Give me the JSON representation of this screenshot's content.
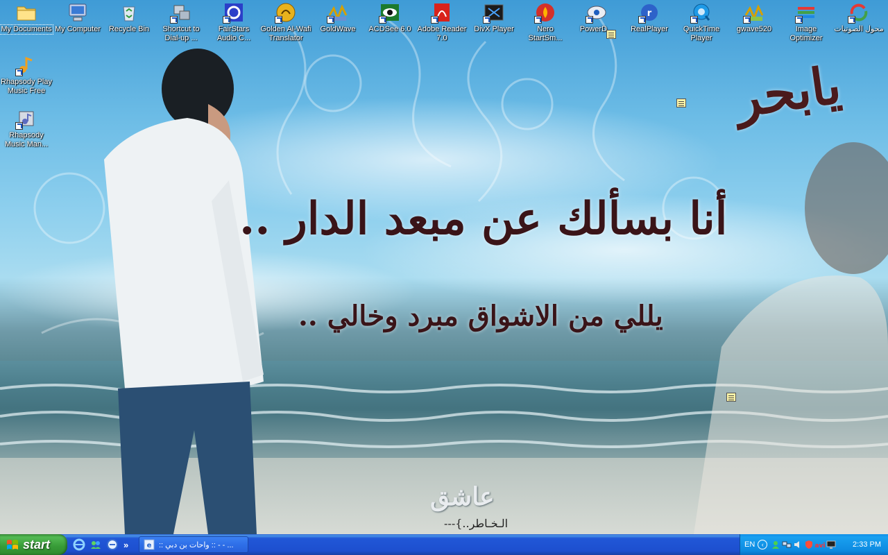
{
  "desktop": {
    "icons_top": [
      {
        "label": "My Documents",
        "icon": "folder-icon"
      },
      {
        "label": "My Computer",
        "icon": "computer-icon"
      },
      {
        "label": "Recycle Bin",
        "icon": "recycle-bin-icon"
      },
      {
        "label": "Shortcut to Dial-up ...",
        "icon": "dialup-icon"
      },
      {
        "label": "FairStars Audio C...",
        "icon": "fairstars-icon"
      },
      {
        "label": "Golden Al-Wafi Translator",
        "icon": "translator-icon"
      },
      {
        "label": "GoldWave",
        "icon": "goldwave-icon"
      },
      {
        "label": "ACDSee 6.0",
        "icon": "acdsee-icon"
      },
      {
        "label": "Adobe Reader 7.0",
        "icon": "adobe-reader-icon"
      },
      {
        "label": "DivX Player",
        "icon": "divx-icon"
      },
      {
        "label": "Nero StartSm...",
        "icon": "nero-icon"
      },
      {
        "label": "PowerD...",
        "icon": "powerdvd-icon"
      },
      {
        "label": "RealPlayer",
        "icon": "realplayer-icon"
      },
      {
        "label": "QuickTime Player",
        "icon": "quicktime-icon"
      },
      {
        "label": "gwave520",
        "icon": "gwave-icon"
      },
      {
        "label": "Image Optimizer",
        "icon": "image-optimizer-icon"
      },
      {
        "label": "محول الصوتيات",
        "icon": "audio-converter-icon"
      }
    ],
    "icons_left": [
      {
        "label": "Rhapsody Play Music Free",
        "icon": "rhapsody-play-icon"
      },
      {
        "label": "Rhapsody Music Man...",
        "icon": "rhapsody-manager-icon"
      }
    ]
  },
  "wallpaper": {
    "title": "يابحر",
    "line1": "أنا بسألك عن مبعد الدار ..",
    "line2": "يللي من الاشواق مبرد وخالي ..",
    "signature": "عاشق",
    "signature_sub": "الـخـاطر..}---"
  },
  "taskbar": {
    "start_label": "start",
    "task_window": ":: واحات بن دبي :: - - ...",
    "quick_more": "»",
    "language": "EN",
    "clock": "2:33 PM"
  },
  "colors": {
    "taskbar_blue": "#245edb",
    "start_green": "#3c9a3c",
    "tray_blue": "#0f8de4"
  }
}
